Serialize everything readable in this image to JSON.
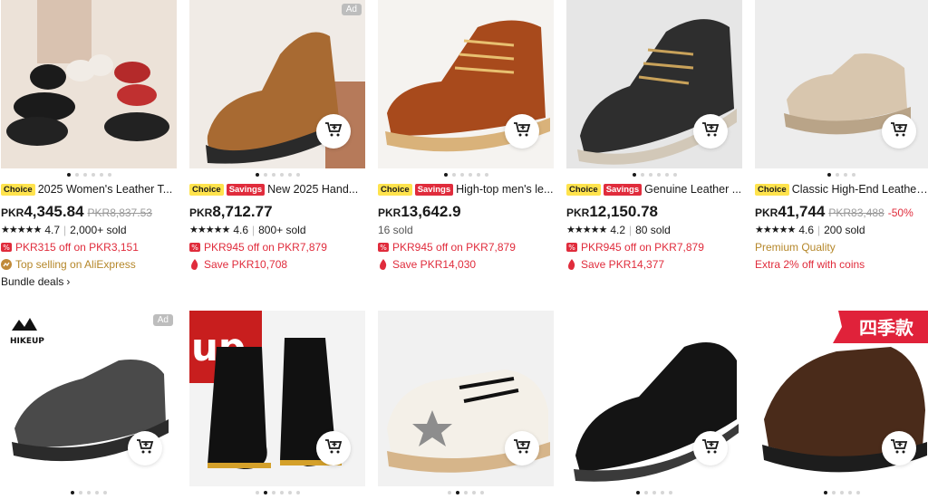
{
  "row1": [
    {
      "title": "2025 Women's Leather T...",
      "badges": [
        "Choice"
      ],
      "currency": "PKR",
      "price": "4,345.84",
      "old_price": "PKR8,837.53",
      "discount": "",
      "rating": "4.7",
      "sold": "2,000+ sold",
      "line1": "PKR315 off on PKR3,151",
      "line2": "Top selling on AliExpress",
      "bundle": "Bundle deals",
      "ad": ""
    },
    {
      "title": "New 2025 Hand...",
      "badges": [
        "Choice",
        "Savings"
      ],
      "currency": "PKR",
      "price": "8,712.77",
      "old_price": "",
      "discount": "",
      "rating": "4.6",
      "sold": "800+ sold",
      "line1": "PKR945 off on PKR7,879",
      "line2": "Save PKR10,708",
      "ad": "Ad"
    },
    {
      "title": "High-top men's le...",
      "badges": [
        "Choice",
        "Savings"
      ],
      "currency": "PKR",
      "price": "13,642.9",
      "old_price": "",
      "discount": "",
      "sold_only": "16 sold",
      "line1": "PKR945 off on PKR7,879",
      "line2": "Save PKR14,030",
      "ad": ""
    },
    {
      "title": "Genuine Leather ...",
      "badges": [
        "Choice",
        "Savings"
      ],
      "currency": "PKR",
      "price": "12,150.78",
      "old_price": "",
      "discount": "",
      "rating": "4.2",
      "sold": "80 sold",
      "line1": "PKR945 off on PKR7,879",
      "line2": "Save PKR14,377",
      "ad": ""
    },
    {
      "title": "Classic High-End Leather...",
      "badges": [
        "Choice"
      ],
      "currency": "PKR",
      "price": "41,744",
      "old_price": "PKR83,488",
      "discount": "-50%",
      "rating": "4.6",
      "sold": "200 sold",
      "line1": "Premium Quality",
      "line2": "Extra 2% off with coins",
      "ad": ""
    }
  ],
  "row2": [
    {
      "ad": "Ad",
      "logo": "HIKEUP"
    },
    {
      "ad": "",
      "logo": "up"
    },
    {
      "ad": ""
    },
    {
      "ad": ""
    },
    {
      "ad": "",
      "banner": "四季款"
    }
  ],
  "icons": {
    "cart": "cart-plus-icon",
    "coupon": "coupon-icon",
    "flame": "flame-icon",
    "trend": "trending-icon"
  },
  "colors": {
    "choice": "#ffe34d",
    "savings": "#e02c3c",
    "red": "#e02c3c",
    "gold": "#b5872a"
  }
}
